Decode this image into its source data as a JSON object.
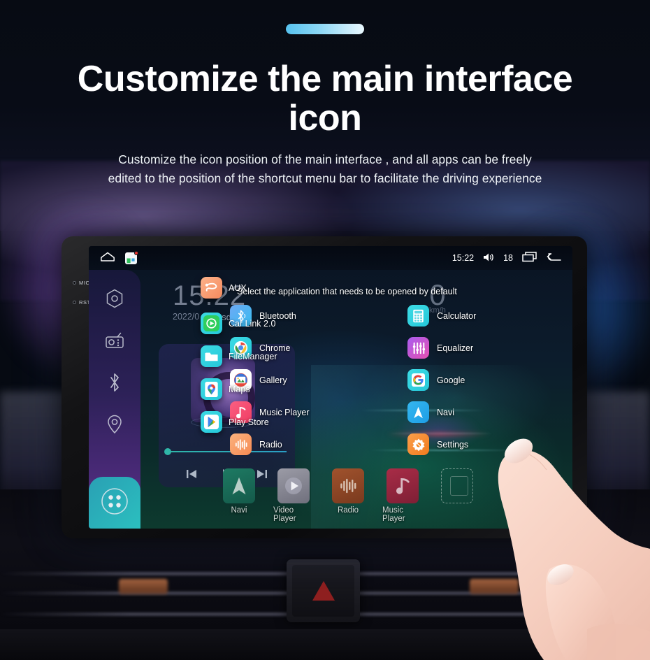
{
  "hero": {
    "pill": "accent-pill",
    "title": "Customize the main interface icon",
    "subtitle": "Customize the icon position of the main interface , and all apps can be freely edited to the position of the shortcut menu bar to facilitate the driving experience"
  },
  "device": {
    "bezel_labels": {
      "mic": "MIC",
      "reset": "RST"
    }
  },
  "status_bar": {
    "home_icon": "home-outline-icon",
    "home_app_icon": "home-app-icon",
    "time": "15:22",
    "volume_icon": "volume-icon",
    "volume_value": "18",
    "recents_icon": "recent-apps-icon",
    "back_icon": "back-arrow-icon"
  },
  "sidebar": {
    "items": [
      {
        "name": "settings",
        "icon": "hexagon-settings-icon"
      },
      {
        "name": "radio",
        "icon": "radio-icon"
      },
      {
        "name": "bluetooth",
        "icon": "bluetooth-icon"
      },
      {
        "name": "navigation",
        "icon": "location-pin-icon"
      }
    ],
    "apps_button": {
      "name": "all-apps",
      "icon": "apps-grid-icon"
    }
  },
  "clock_widget": {
    "time": "15:22",
    "date": "2022/0",
    "weekday": "Tuesday"
  },
  "speed_widget": {
    "value": "0",
    "unit": "km/h"
  },
  "music_widget": {
    "prev_icon": "skip-previous-icon",
    "play_icon": "play-icon",
    "next_icon": "skip-next-icon"
  },
  "chooser": {
    "title": "Select the application that needs to be opened by default",
    "apps": [
      {
        "label": "Bluetooth",
        "icon": "bluetooth-icon",
        "color": "#3bb9f0"
      },
      {
        "label": "Calculator",
        "icon": "calculator-icon",
        "color": "#35d2e0"
      },
      {
        "label": "Chrome",
        "icon": "chrome-icon",
        "color": "#2ecbe0"
      },
      {
        "label": "Equalizer",
        "icon": "equalizer-icon",
        "color": "#a24ce0"
      },
      {
        "label": "Gallery",
        "icon": "gallery-icon",
        "color": "#ffffff"
      },
      {
        "label": "Google",
        "icon": "google-icon",
        "color": "#2ecbe0"
      },
      {
        "label": "Music Player",
        "icon": "music-note-icon",
        "color": "#f24d6e"
      },
      {
        "label": "Navi",
        "icon": "navigation-arrow-icon",
        "color": "#2ab4ea"
      },
      {
        "label": "Radio",
        "icon": "radio-wave-icon",
        "color": "#f79b5e"
      },
      {
        "label": "Settings",
        "icon": "gear-icon",
        "color": "#f58220"
      }
    ]
  },
  "dragged_icons": {
    "aux": {
      "label": "AUX",
      "icon": "aux-cable-icon",
      "color": "#f79b6a"
    },
    "items": [
      {
        "label": "Car Link 2.0",
        "icon": "car-link-icon",
        "color": "#2ecbe0"
      },
      {
        "label": "FileManager",
        "icon": "folder-icon",
        "color": "#2ecbe0"
      },
      {
        "label": "Maps",
        "icon": "maps-pin-icon",
        "color": "#2ecbe0"
      },
      {
        "label": "Play Store",
        "icon": "play-store-icon",
        "color": "#2ecbe0"
      }
    ]
  },
  "dock": {
    "items": [
      {
        "label": "Navi",
        "icon": "navigation-arrow-icon",
        "color": "#1c6b5a"
      },
      {
        "label": "Video Player",
        "icon": "video-play-icon",
        "color": "#8f8f99"
      },
      {
        "label": "Radio",
        "icon": "radio-wave-icon",
        "color": "#8c4a2a"
      },
      {
        "label": "Music Player",
        "icon": "music-note-icon",
        "color": "#9c2740"
      }
    ],
    "empty_slot": "empty-dock-slot"
  },
  "car_controls": {
    "hazard_button": "hazard-light-button"
  },
  "colors": {
    "accent": "#56c2ef",
    "page_bg": "#060a12",
    "sidebar_top": "#17183a",
    "sidebar_bottom": "#6c3b96"
  }
}
